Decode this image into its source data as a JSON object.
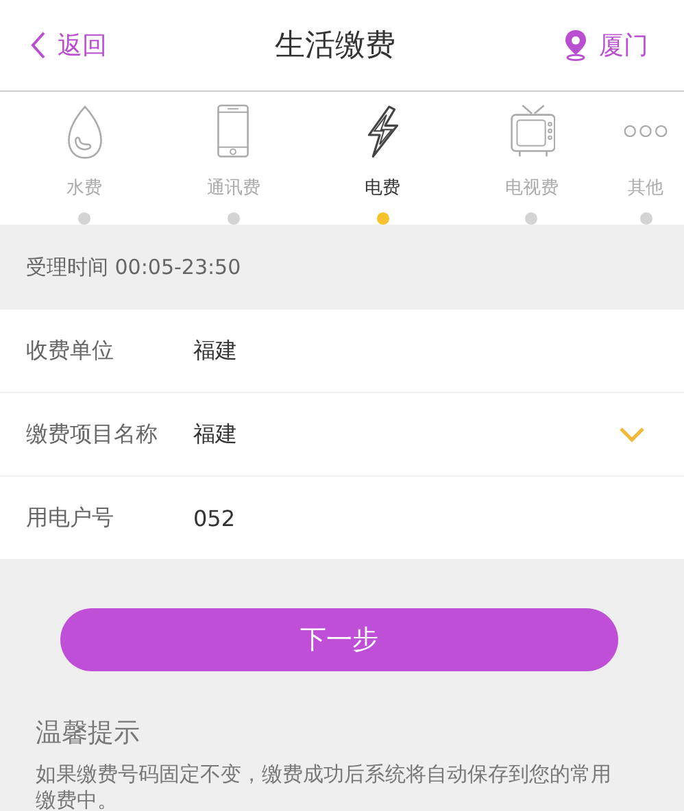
{
  "header": {
    "back": "返回",
    "title": "生活缴费",
    "city": "厦门"
  },
  "categories": [
    {
      "kind": "water",
      "label": "水费",
      "selected": false
    },
    {
      "kind": "phone",
      "label": "通讯费",
      "selected": false
    },
    {
      "kind": "power",
      "label": "电费",
      "selected": true
    },
    {
      "kind": "tv",
      "label": "电视费",
      "selected": false
    },
    {
      "kind": "more",
      "label": "其他",
      "selected": false
    }
  ],
  "hours": "受理时间 00:05-23:50",
  "form": [
    {
      "kind": "text",
      "label": "收费单位",
      "value": "福建"
    },
    {
      "kind": "select",
      "label": "缴费项目名称",
      "value": "福建"
    },
    {
      "kind": "text",
      "label": "用电户号",
      "value": "052"
    }
  ],
  "next_button": "下一步",
  "tips": {
    "title": "温馨提示",
    "text": "如果缴费号码固定不变，缴费成功后系统将自动保存到您的常用缴费中。"
  }
}
